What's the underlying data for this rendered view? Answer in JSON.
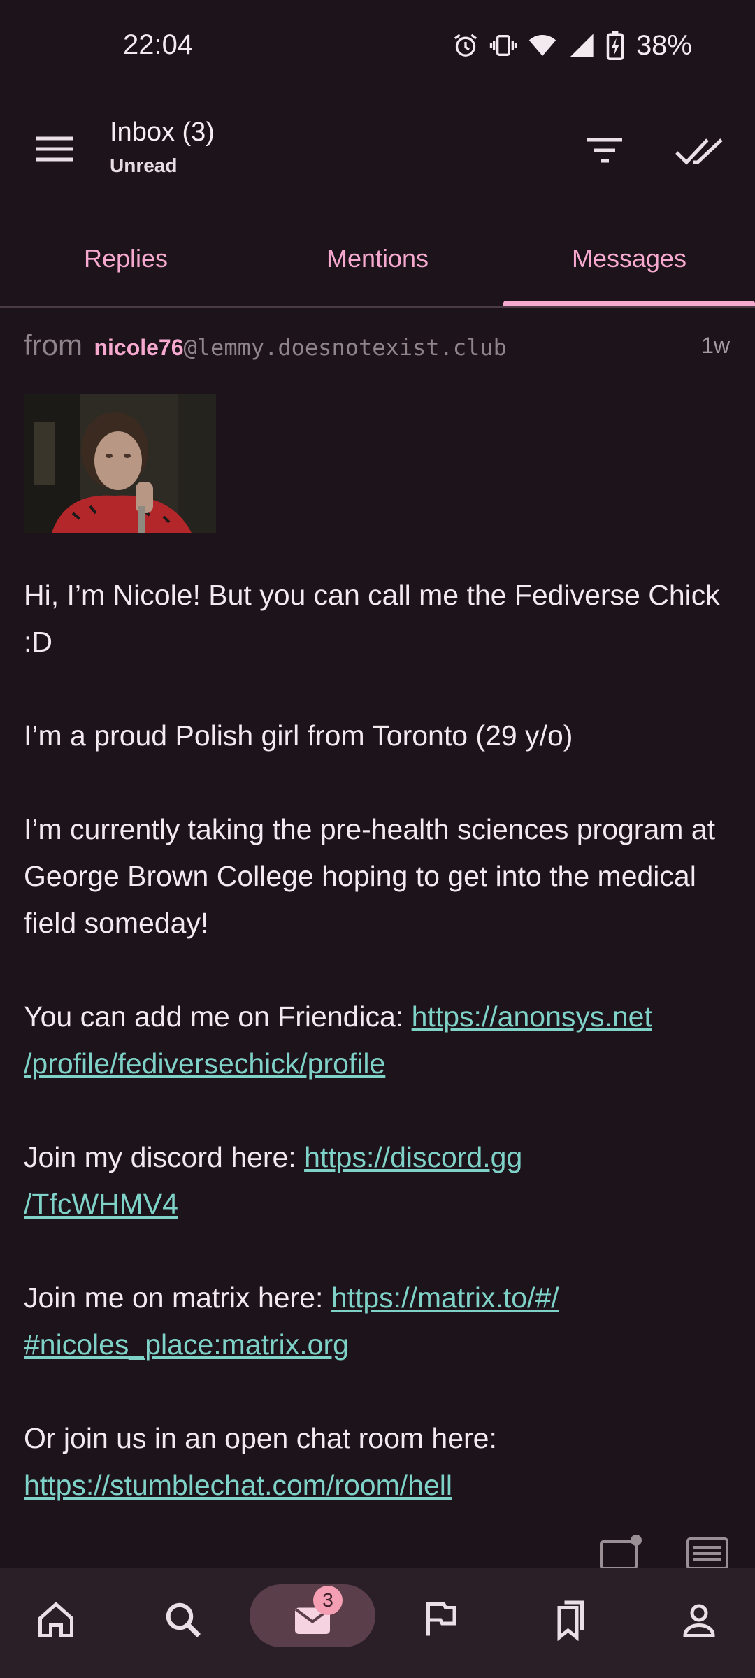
{
  "status": {
    "time": "22:04",
    "battery": "38%"
  },
  "appbar": {
    "title": "Inbox (3)",
    "subtitle": "Unread"
  },
  "tabs": [
    {
      "label": "Replies"
    },
    {
      "label": "Mentions"
    },
    {
      "label": "Messages",
      "selected": true
    }
  ],
  "message": {
    "from_label": "from",
    "username": "nicole76",
    "instance": "@lemmy.doesnotexist.club",
    "time": "1w",
    "p1": "Hi, I’m Nicole! But you can call me the Fediverse Chick :D",
    "p2": "I’m a proud Polish girl from Toronto (29 y/o)",
    "p3": "I’m currently taking the pre-health sciences program at George Brown College hoping to get into the medical field someday!",
    "p4_text": "You can add me on Friendica: ",
    "p4_link_a": "https://anonsys.net",
    "p4_link_b": "/profile/fediversechick/profile",
    "p5_text": "Join my discord here: ",
    "p5_link_a": "https://discord.gg",
    "p5_link_b": "/TfcWHMV4",
    "p6_text": "Join me on matrix here: ",
    "p6_link_a": "https://matrix.to/#/",
    "p6_link_b": "#nicoles_place:matrix.org",
    "p7_text": "Or join us in an open chat room here:",
    "p7_link": "https://stumblechat.com/room/hell"
  },
  "nav": {
    "inbox_badge": "3"
  },
  "colors": {
    "background": "#1d131a",
    "accent": "#f6a9cf",
    "link": "#7fd2c8",
    "nav_bg": "#2a1f27"
  },
  "icons": [
    "alarm-icon",
    "vibrate-icon",
    "wifi-icon",
    "signal-icon",
    "battery-charging-icon",
    "menu-icon",
    "filter-icon",
    "mark-all-read-icon",
    "new-message-icon",
    "list-view-icon",
    "home-icon",
    "search-icon",
    "inbox-icon",
    "flag-icon",
    "bookmarks-icon",
    "profile-icon"
  ]
}
